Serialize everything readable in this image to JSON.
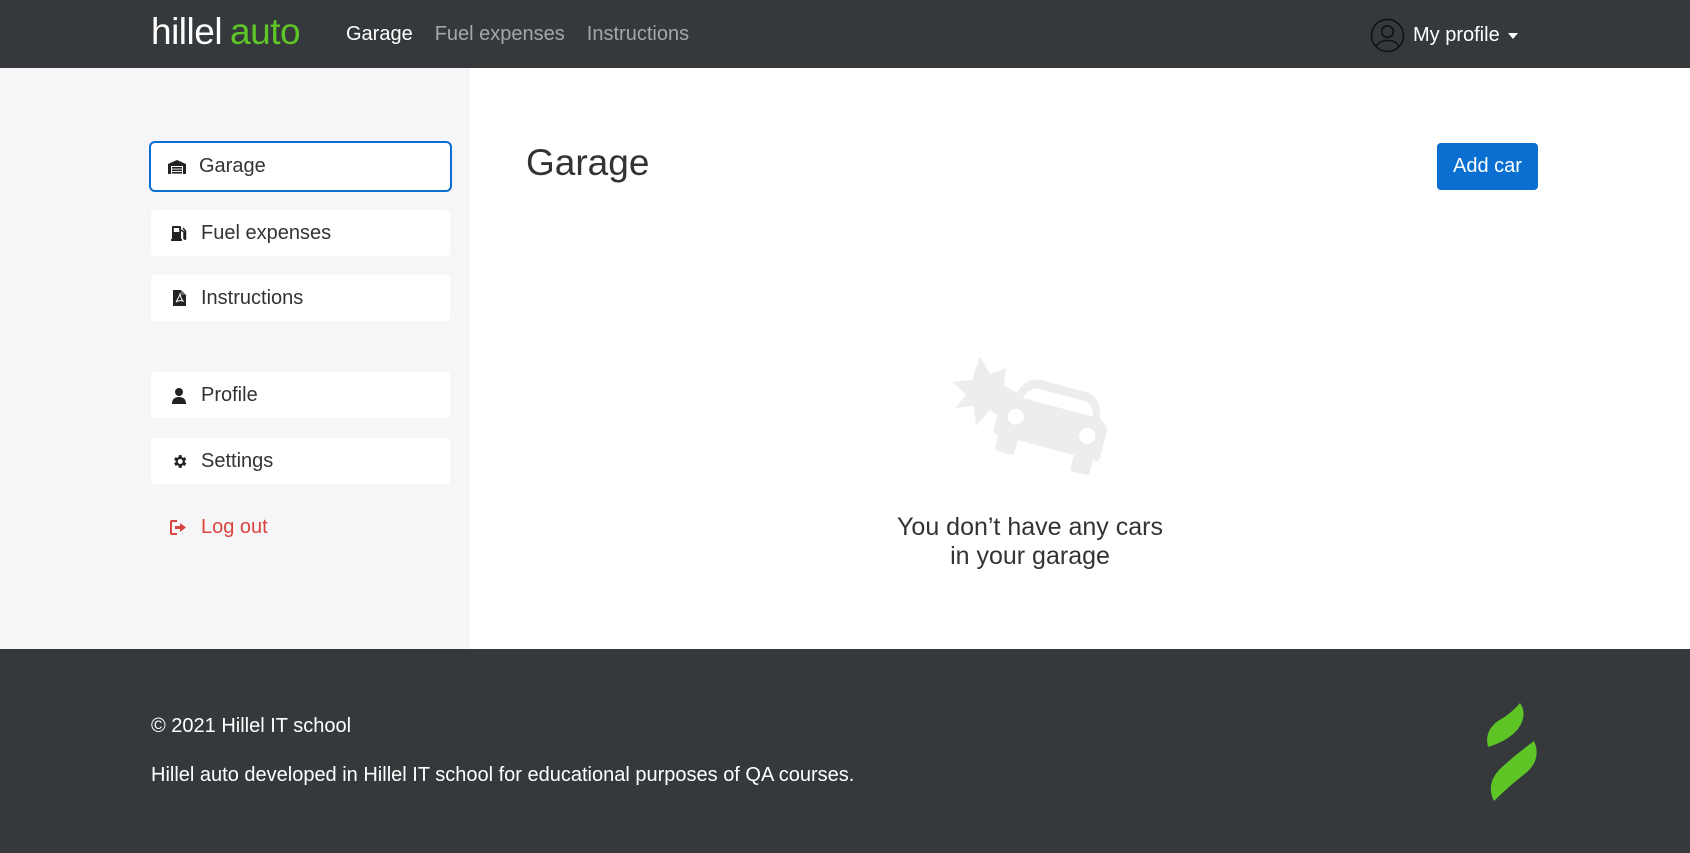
{
  "header": {
    "logo_main": "hillel",
    "logo_accent": "auto",
    "nav": [
      {
        "label": "Garage",
        "active": true
      },
      {
        "label": "Fuel expenses",
        "active": false
      },
      {
        "label": "Instructions",
        "active": false
      }
    ],
    "profile_label": "My profile"
  },
  "sidebar": {
    "items": [
      {
        "label": "Garage",
        "icon": "garage-icon",
        "active": true
      },
      {
        "label": "Fuel expenses",
        "icon": "fuel-icon"
      },
      {
        "label": "Instructions",
        "icon": "pdf-file-icon"
      },
      {
        "label": "Profile",
        "icon": "user-icon"
      },
      {
        "label": "Settings",
        "icon": "gear-icon"
      },
      {
        "label": "Log out",
        "icon": "logout-icon"
      }
    ]
  },
  "main": {
    "title": "Garage",
    "add_button": "Add car",
    "empty_line1": "You don’t have any cars",
    "empty_line2": "in your garage"
  },
  "footer": {
    "copyright": "© 2021 Hillel IT school",
    "description": "Hillel auto developed in Hillel IT school for educational purposes of QA courses."
  },
  "colors": {
    "header_bg": "#35393c",
    "accent_green": "#5ec527",
    "primary_blue": "#0a6fd1",
    "logout_red": "#d9443e",
    "sidebar_bg": "#f6f6f8"
  }
}
